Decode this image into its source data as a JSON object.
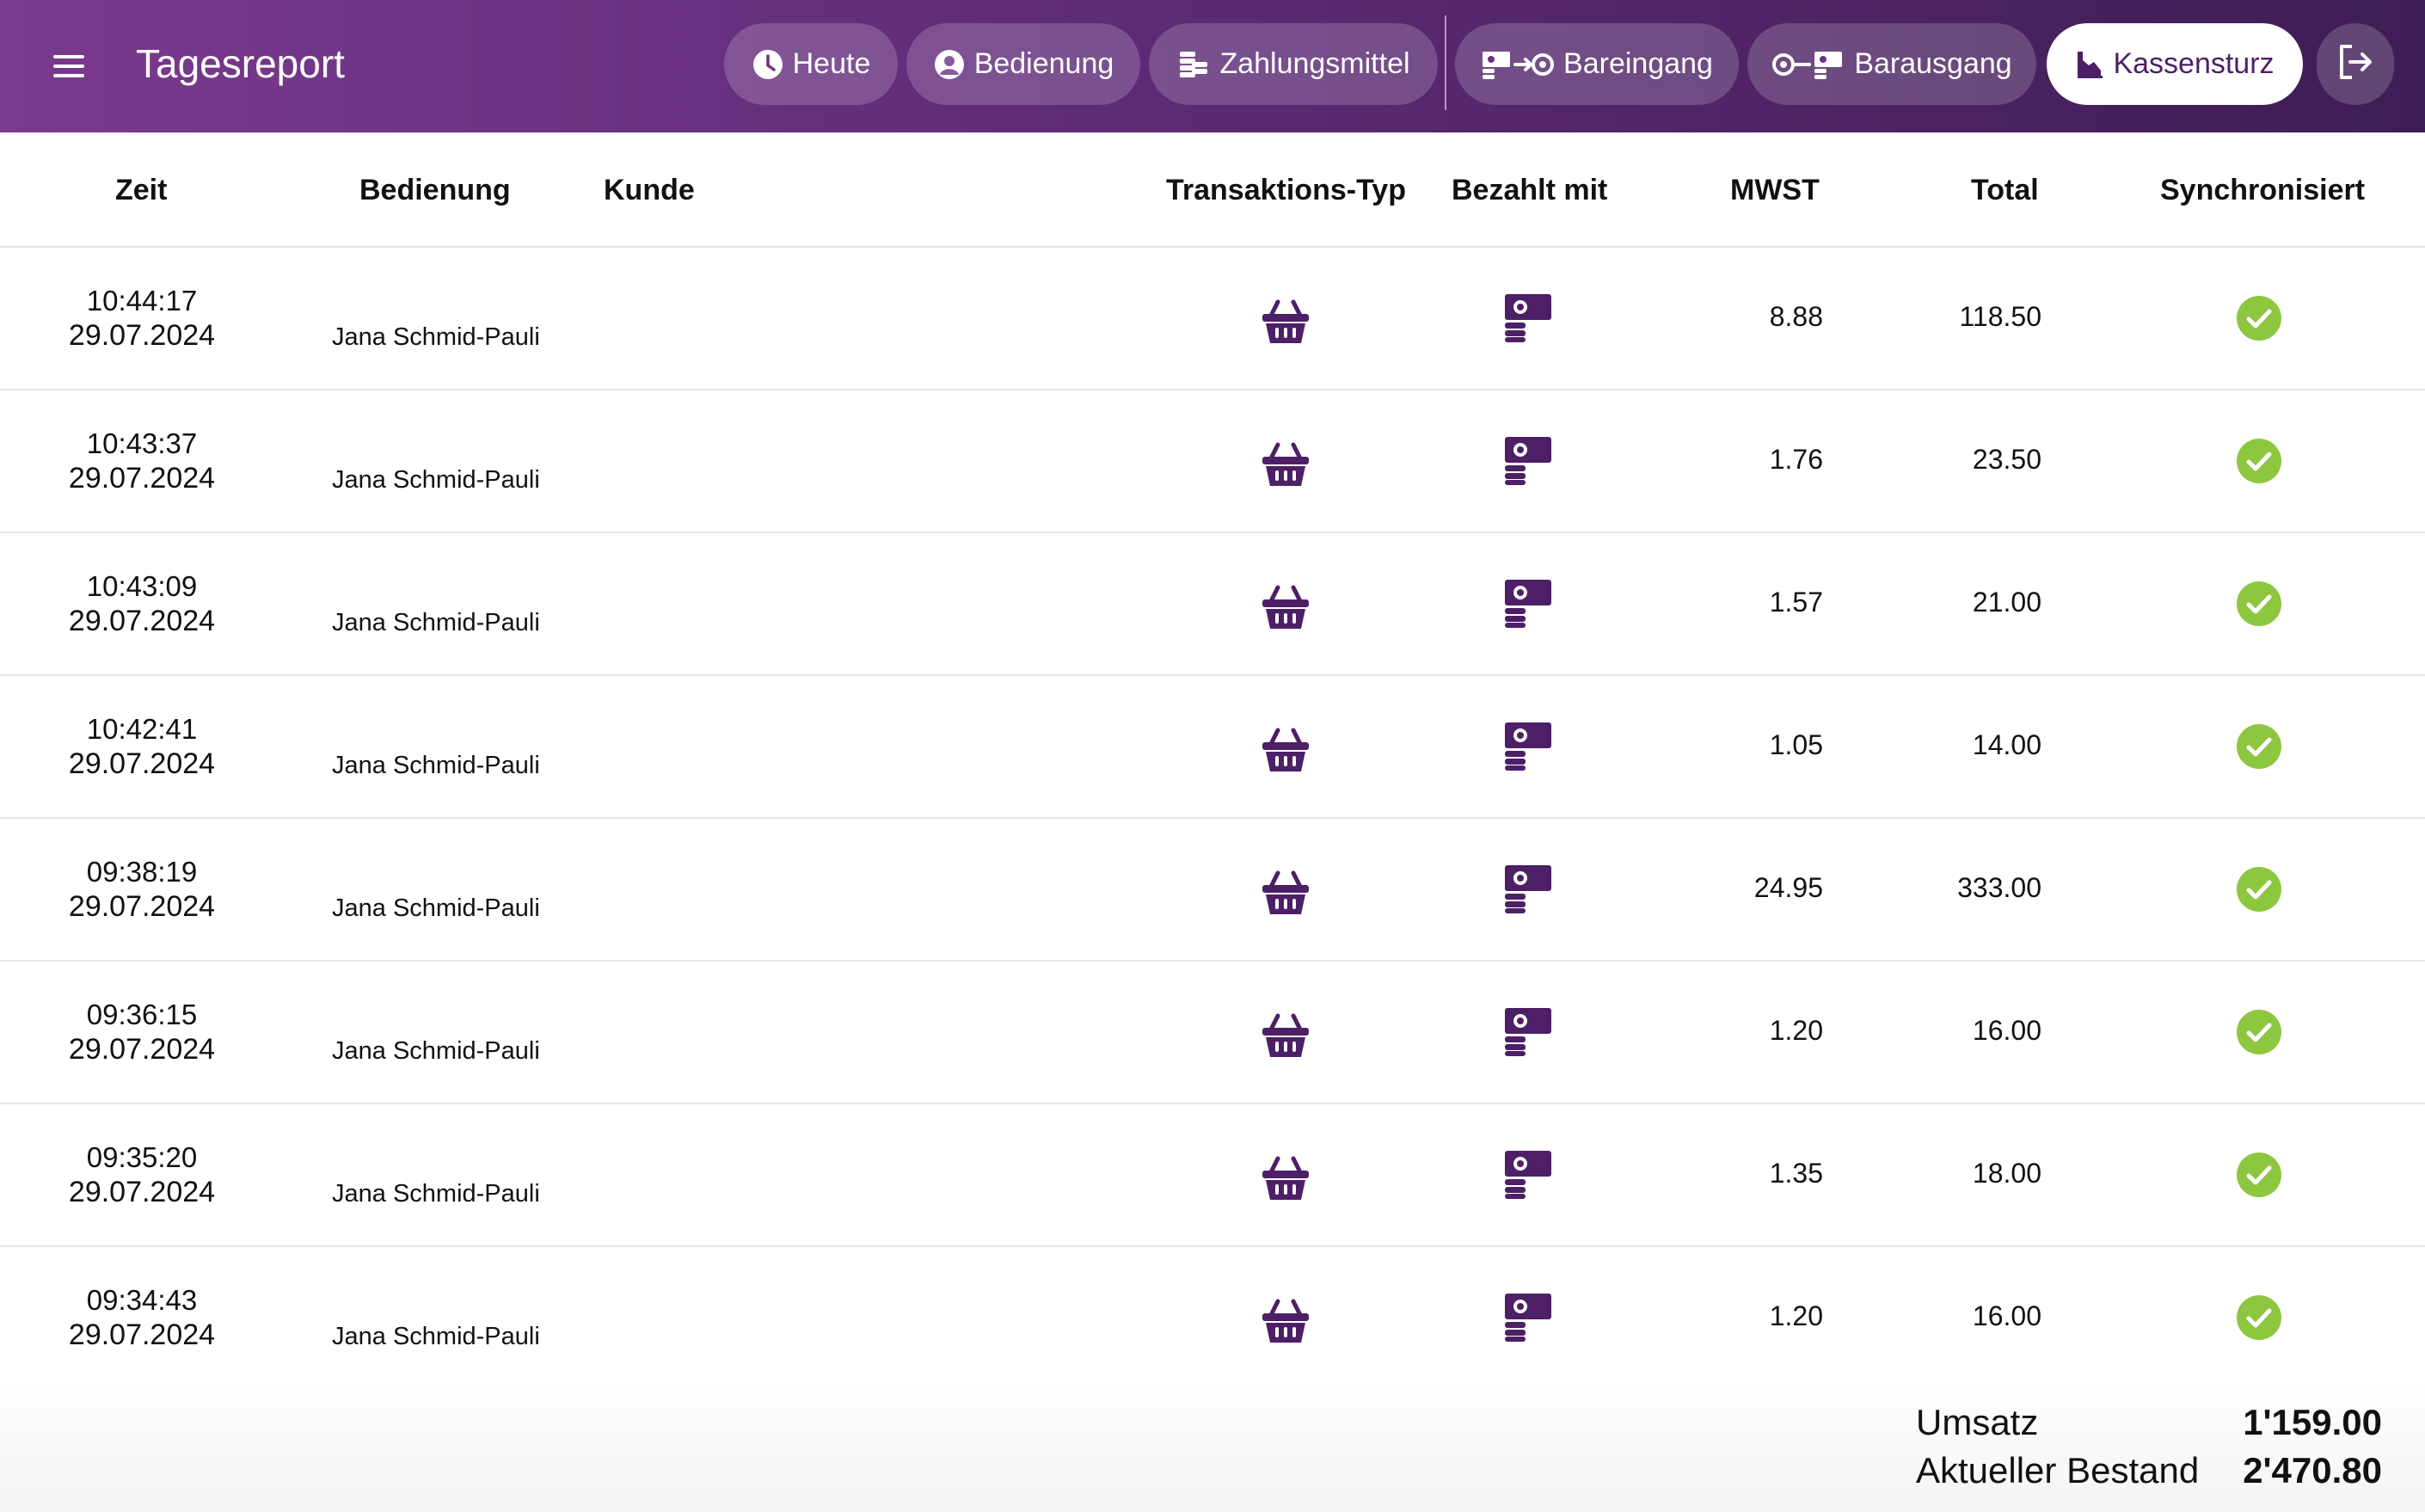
{
  "app": {
    "title": "Tagesreport"
  },
  "nav": {
    "heute": "Heute",
    "bedienung": "Bedienung",
    "zahlungsmittel": "Zahlungsmittel",
    "bareingang": "Bareingang",
    "barausgang": "Barausgang",
    "kassensturz": "Kassensturz",
    "active": "kassensturz"
  },
  "table": {
    "headers": {
      "zeit": "Zeit",
      "bedienung": "Bedienung",
      "kunde": "Kunde",
      "typ": "Transaktions-Typ",
      "bezahlt": "Bezahlt mit",
      "mwst": "MWST",
      "total": "Total",
      "sync": "Synchronisiert"
    },
    "rows": [
      {
        "time": "10:44:17",
        "date": "29.07.2024",
        "user": "Jana Schmid-Pauli",
        "kunde": "",
        "type_icon": "basket-icon",
        "paid_icon": "cash-icon",
        "mwst": "8.88",
        "total": "118.50",
        "synced": true
      },
      {
        "time": "10:43:37",
        "date": "29.07.2024",
        "user": "Jana Schmid-Pauli",
        "kunde": "",
        "type_icon": "basket-icon",
        "paid_icon": "cash-icon",
        "mwst": "1.76",
        "total": "23.50",
        "synced": true
      },
      {
        "time": "10:43:09",
        "date": "29.07.2024",
        "user": "Jana Schmid-Pauli",
        "kunde": "",
        "type_icon": "basket-icon",
        "paid_icon": "cash-icon",
        "mwst": "1.57",
        "total": "21.00",
        "synced": true
      },
      {
        "time": "10:42:41",
        "date": "29.07.2024",
        "user": "Jana Schmid-Pauli",
        "kunde": "",
        "type_icon": "basket-icon",
        "paid_icon": "cash-icon",
        "mwst": "1.05",
        "total": "14.00",
        "synced": true
      },
      {
        "time": "09:38:19",
        "date": "29.07.2024",
        "user": "Jana Schmid-Pauli",
        "kunde": "",
        "type_icon": "basket-icon",
        "paid_icon": "cash-icon",
        "mwst": "24.95",
        "total": "333.00",
        "synced": true
      },
      {
        "time": "09:36:15",
        "date": "29.07.2024",
        "user": "Jana Schmid-Pauli",
        "kunde": "",
        "type_icon": "basket-icon",
        "paid_icon": "cash-icon",
        "mwst": "1.20",
        "total": "16.00",
        "synced": true
      },
      {
        "time": "09:35:20",
        "date": "29.07.2024",
        "user": "Jana Schmid-Pauli",
        "kunde": "",
        "type_icon": "basket-icon",
        "paid_icon": "cash-icon",
        "mwst": "1.35",
        "total": "18.00",
        "synced": true
      },
      {
        "time": "09:34:43",
        "date": "29.07.2024",
        "user": "Jana Schmid-Pauli",
        "kunde": "",
        "type_icon": "basket-icon",
        "paid_icon": "cash-icon",
        "mwst": "1.20",
        "total": "16.00",
        "synced": true
      }
    ]
  },
  "summary": {
    "umsatz_label": "Umsatz",
    "umsatz_value": "1'159.00",
    "bestand_label": "Aktueller Bestand",
    "bestand_value": "2'470.80"
  },
  "colors": {
    "header_gradient_start": "#7a3a8e",
    "header_gradient_end": "#3f1d55",
    "icon_purple": "#4d1f66",
    "sync_green": "#8dc63f"
  }
}
